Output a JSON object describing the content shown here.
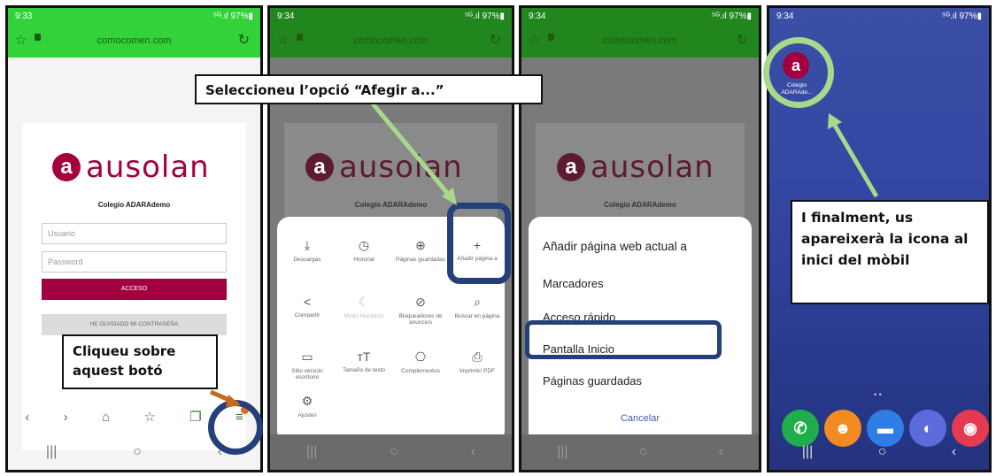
{
  "status": {
    "time_1": "9:33",
    "time_2": "9:34",
    "time_3": "9:34",
    "time_4": "9:34",
    "signal": "⁵ᴳ.ıl 97%▮"
  },
  "browser": {
    "url": "comocomen.com"
  },
  "login": {
    "brand": "ausolan",
    "logo_letter": "a",
    "school": "Colegio ADARAdemo",
    "user_placeholder": "Usuario",
    "password_placeholder": "Password",
    "access_label": "ACCESO",
    "forgot_label": "HE OLVIDADO MI CONTRASEÑA"
  },
  "menu": {
    "items": [
      "Descargas",
      "Historial",
      "Páginas guardadas",
      "Añadir página a",
      "Compartir",
      "Modo Nocturno",
      "Bloqueadores de anuncios",
      "Buscar en página",
      "Sitio versión escritorio",
      "Tamaño de texto",
      "Complementos",
      "Imprimir/ PDF",
      "Ajustes"
    ],
    "icons": [
      "download-icon",
      "history-icon",
      "saved-pages-icon",
      "plus-icon",
      "share-icon",
      "moon-icon",
      "blocker-icon",
      "search-page-icon",
      "desktop-icon",
      "text-size-icon",
      "addons-icon",
      "print-icon",
      "settings-icon"
    ]
  },
  "add_sheet": {
    "title": "Añadir página web actual a",
    "options": [
      "Marcadores",
      "Acceso rápido",
      "Pantalla Inicio",
      "Páginas guardadas"
    ],
    "cancel": "Cancelar"
  },
  "home": {
    "app_label": "Colegio ADARAde..."
  },
  "callouts": {
    "step1": "Cliqueu sobre aquest botó",
    "step2": "Seleccioneu l’opció “Afegir a...”",
    "step3": "I finalment, us apareixerà la icona al inici del mòbil"
  },
  "colors": {
    "green": "#33d23a",
    "brand": "#a3003f",
    "ring": "#23407a",
    "arrow_green": "#a8d88a",
    "arrow_orange": "#c8671e"
  }
}
